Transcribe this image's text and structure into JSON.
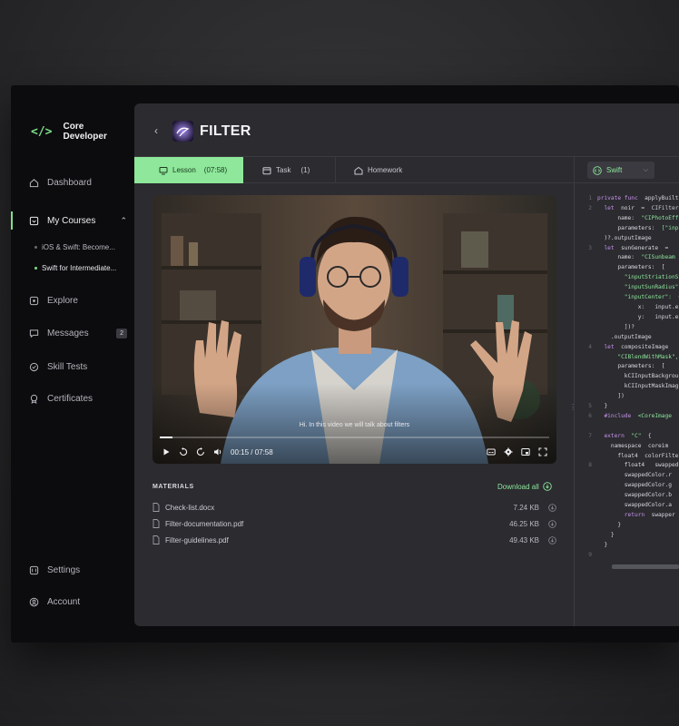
{
  "brand": {
    "line1": "Core",
    "line2": "Developer",
    "icon": "code-brackets-icon"
  },
  "sidebar": {
    "items": [
      {
        "label": "Dashboard",
        "icon": "home-icon"
      },
      {
        "label": "My Courses",
        "icon": "courses-icon"
      },
      {
        "label": "Explore",
        "icon": "explore-icon"
      },
      {
        "label": "Messages",
        "icon": "chat-icon",
        "badge": "2"
      },
      {
        "label": "Skill Tests",
        "icon": "test-icon"
      },
      {
        "label": "Certificates",
        "icon": "certificate-icon"
      },
      {
        "label": "Settings",
        "icon": "settings-icon"
      },
      {
        "label": "Account",
        "icon": "account-icon"
      }
    ],
    "courses": [
      {
        "label": "iOS & Swift: Become..."
      },
      {
        "label": "Swift for Intermediate..."
      }
    ]
  },
  "header": {
    "back": "‹",
    "title": "FILTER"
  },
  "tabs": [
    {
      "label": "Lesson",
      "count": "(07:58)"
    },
    {
      "label": "Task",
      "count": "(1)"
    },
    {
      "label": "Homework",
      "count": ""
    }
  ],
  "language": {
    "label": "Swift"
  },
  "video": {
    "subtitle": "Hi. In this video we will talk about filters",
    "time": "00:15 / 07:58",
    "progress": 0.032
  },
  "materials": {
    "title": "MATERIALS",
    "download_all": "Download all",
    "files": [
      {
        "name": "Check-list.docx",
        "size": "7.24 KB"
      },
      {
        "name": "Filter-documentation.pdf",
        "size": "46.25 KB"
      },
      {
        "name": "Filter-guidelines.pdf",
        "size": "49.43 KB"
      }
    ]
  },
  "code": {
    "lines": [
      {
        "n": "1",
        "parts": [
          [
            "kw",
            "private func  "
          ],
          [
            "tx",
            "applyBuilt"
          ]
        ]
      },
      {
        "n": "2",
        "parts": [
          [
            "tx",
            "  "
          ],
          [
            "kw",
            "let "
          ],
          [
            "tx",
            " noir  =  "
          ],
          [
            "ty",
            "CIFilter("
          ]
        ]
      },
      {
        "n": "",
        "parts": [
          [
            "tx",
            "      name:  "
          ],
          [
            "str",
            "\"CIPhotoEff"
          ]
        ]
      },
      {
        "n": "",
        "parts": [
          [
            "tx",
            "      parameters:  "
          ],
          [
            "str",
            "[\"inpu"
          ]
        ]
      },
      {
        "n": "",
        "parts": [
          [
            "tx",
            "  )?.outputImage"
          ]
        ]
      },
      {
        "n": "3",
        "parts": [
          [
            "tx",
            "  "
          ],
          [
            "kw",
            "let "
          ],
          [
            "tx",
            " sunGenerate  ="
          ]
        ]
      },
      {
        "n": "",
        "parts": [
          [
            "tx",
            "      name:  "
          ],
          [
            "str",
            "\"CISunbeam"
          ]
        ]
      },
      {
        "n": "",
        "parts": [
          [
            "tx",
            "      parameters:  ["
          ]
        ]
      },
      {
        "n": "",
        "parts": [
          [
            "str",
            "        \"inputStriationStre"
          ]
        ]
      },
      {
        "n": "",
        "parts": [
          [
            "str",
            "        \"inputSunRadius\":"
          ]
        ]
      },
      {
        "n": "",
        "parts": [
          [
            "str",
            "        \"inputCenter\":  "
          ],
          [
            "tx",
            "C"
          ]
        ]
      },
      {
        "n": "",
        "parts": [
          [
            "tx",
            "            x:   input.extent."
          ]
        ]
      },
      {
        "n": "",
        "parts": [
          [
            "tx",
            "            y:   input.extent."
          ]
        ]
      },
      {
        "n": "",
        "parts": [
          [
            "tx",
            "        ])?"
          ]
        ]
      },
      {
        "n": "",
        "parts": [
          [
            "tx",
            "    .outputImage"
          ]
        ]
      },
      {
        "n": "4",
        "parts": [
          [
            "tx",
            "  "
          ],
          [
            "kw",
            "let "
          ],
          [
            "tx",
            " compositeImage"
          ]
        ]
      },
      {
        "n": "",
        "parts": [
          [
            "str",
            "      \"CIBlendWithMask\","
          ]
        ]
      },
      {
        "n": "",
        "parts": [
          [
            "tx",
            "      parameters:  ["
          ]
        ]
      },
      {
        "n": "",
        "parts": [
          [
            "tx",
            "        kCIInputBackgrou"
          ]
        ]
      },
      {
        "n": "",
        "parts": [
          [
            "tx",
            "        kCIInputMaskImag"
          ]
        ]
      },
      {
        "n": "",
        "parts": [
          [
            "tx",
            "      ])"
          ]
        ]
      },
      {
        "n": "5",
        "parts": [
          [
            "tx",
            "  }"
          ]
        ]
      },
      {
        "n": "6",
        "parts": [
          [
            "kw",
            "  #include  "
          ],
          [
            "str",
            "<CoreImage"
          ]
        ]
      },
      {
        "n": "",
        "parts": [
          [
            "tx",
            " "
          ]
        ]
      },
      {
        "n": "7",
        "parts": [
          [
            "kw",
            "  extern  "
          ],
          [
            "str",
            "\"C\""
          ],
          [
            "tx",
            "  {"
          ]
        ]
      },
      {
        "n": "",
        "parts": [
          [
            "tx",
            "    namespace  coreim"
          ]
        ]
      },
      {
        "n": "",
        "parts": [
          [
            "tx",
            "      float4  colorFilter"
          ]
        ]
      },
      {
        "n": "8",
        "parts": [
          [
            "tx",
            "        float4   swapped"
          ]
        ]
      },
      {
        "n": "",
        "parts": [
          [
            "tx",
            "        swappedColor.r"
          ]
        ]
      },
      {
        "n": "",
        "parts": [
          [
            "tx",
            "        swappedColor.g"
          ]
        ]
      },
      {
        "n": "",
        "parts": [
          [
            "tx",
            "        swappedColor.b"
          ]
        ]
      },
      {
        "n": "",
        "parts": [
          [
            "tx",
            "        swappedColor.a"
          ]
        ]
      },
      {
        "n": "",
        "parts": [
          [
            "kw",
            "        return  "
          ],
          [
            "tx",
            "swapper"
          ]
        ]
      },
      {
        "n": "",
        "parts": [
          [
            "tx",
            "      }"
          ]
        ]
      },
      {
        "n": "",
        "parts": [
          [
            "tx",
            "    }"
          ]
        ]
      },
      {
        "n": "",
        "parts": [
          [
            "tx",
            "  }"
          ]
        ]
      },
      {
        "n": "9",
        "parts": [
          [
            "tx",
            " "
          ]
        ]
      }
    ]
  },
  "colors": {
    "accent": "#8ee79a",
    "panel": "#2b2b30",
    "sidebar": "#0c0c0e"
  }
}
